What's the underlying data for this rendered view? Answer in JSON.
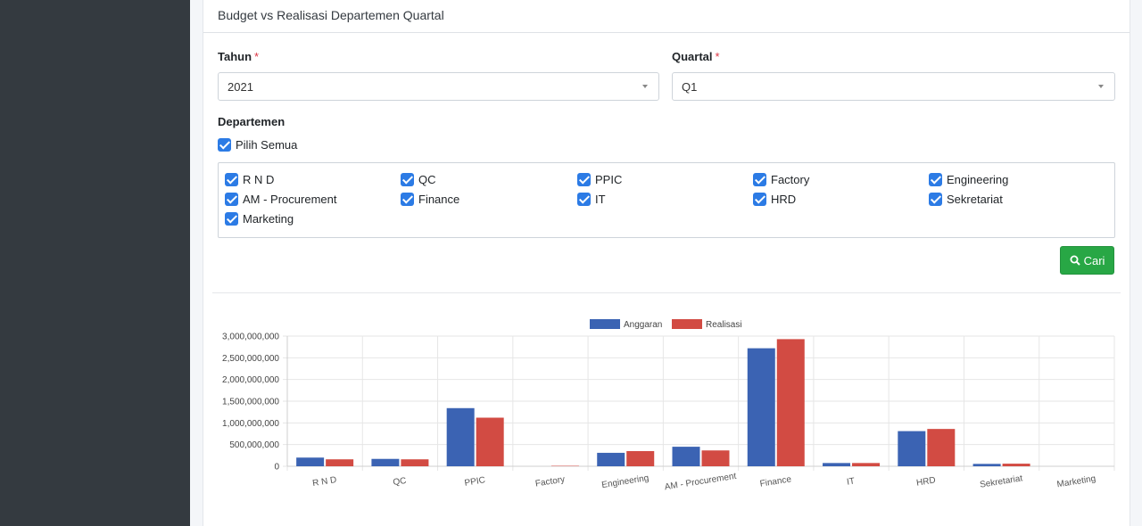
{
  "card": {
    "title": "Budget vs Realisasi Departemen Quartal"
  },
  "form": {
    "tahun_label": "Tahun",
    "tahun_value": "2021",
    "quartal_label": "Quartal",
    "quartal_value": "Q1",
    "required_mark": "*",
    "departemen_label": "Departemen",
    "pilih_semua": "Pilih Semua",
    "departments": [
      "R N D",
      "QC",
      "PPIC",
      "Factory",
      "Engineering",
      "AM - Procurement",
      "Finance",
      "IT",
      "HRD",
      "Sekretariat",
      "Marketing"
    ],
    "search_button": "Cari"
  },
  "colors": {
    "anggaran": "#3b63b3",
    "realisasi": "#d24b43",
    "button": "#28a745",
    "checkbox": "#2c7be5"
  },
  "chart_data": {
    "type": "bar",
    "categories": [
      "R N D",
      "QC",
      "PPIC",
      "Factory",
      "Engineering",
      "AM - Procurement",
      "Finance",
      "IT",
      "HRD",
      "Sekretariat",
      "Marketing"
    ],
    "series": [
      {
        "name": "Anggaran",
        "values": [
          200000000,
          170000000,
          1340000000,
          0,
          310000000,
          450000000,
          2720000000,
          75000000,
          810000000,
          55000000,
          0
        ]
      },
      {
        "name": "Realisasi",
        "values": [
          160000000,
          160000000,
          1120000000,
          10000000,
          350000000,
          365000000,
          2930000000,
          75000000,
          860000000,
          60000000,
          0
        ]
      }
    ],
    "yticks": [
      "0",
      "500,000,000",
      "1,000,000,000",
      "1,500,000,000",
      "2,000,000,000",
      "2,500,000,000",
      "3,000,000,000"
    ],
    "ylim": [
      0,
      3000000000
    ],
    "legend_position": "top",
    "grid": true
  }
}
